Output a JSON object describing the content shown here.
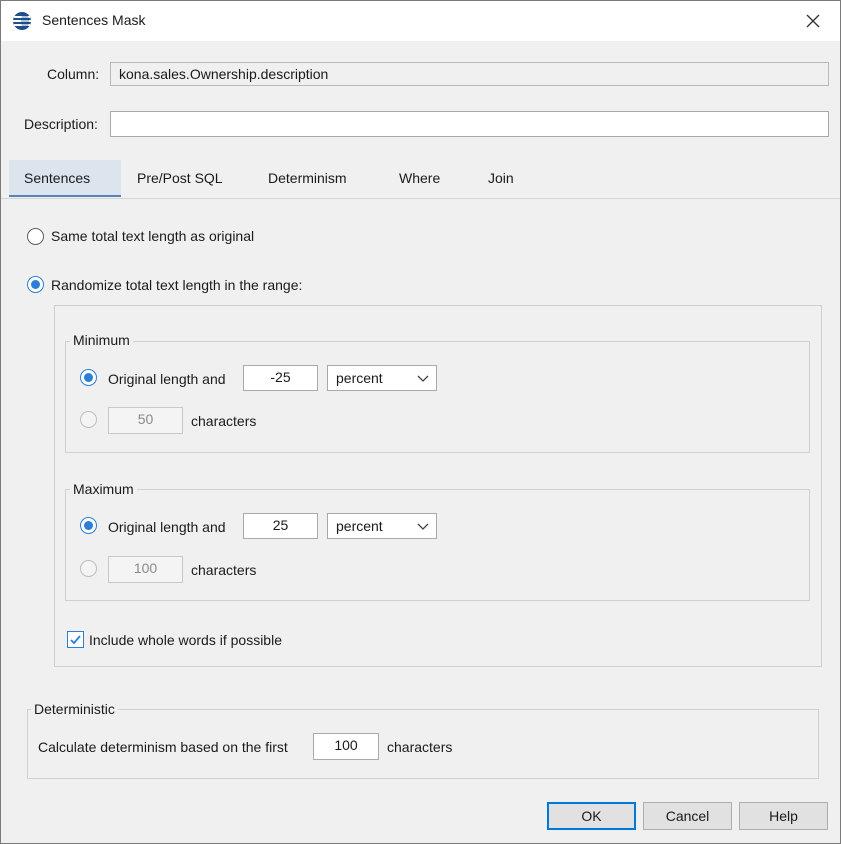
{
  "window": {
    "title": "Sentences Mask"
  },
  "column": {
    "label": "Column:",
    "value": "kona.sales.Ownership.description"
  },
  "description": {
    "label": "Description:",
    "value": ""
  },
  "tabs": [
    {
      "label": "Sentences",
      "active": true
    },
    {
      "label": "Pre/Post SQL",
      "active": false
    },
    {
      "label": "Determinism",
      "active": false
    },
    {
      "label": "Where",
      "active": false
    },
    {
      "label": "Join",
      "active": false
    }
  ],
  "options": {
    "same_length_label": "Same total text length as original",
    "randomize_label": "Randomize total text length in the range:",
    "selected": "randomize"
  },
  "minimum": {
    "title": "Minimum",
    "original_label": "Original length and",
    "original_value": "-25",
    "unit": "percent",
    "chars_value": "50",
    "chars_label": "characters",
    "selected": "original"
  },
  "maximum": {
    "title": "Maximum",
    "original_label": "Original length and",
    "original_value": "25",
    "unit": "percent",
    "chars_value": "100",
    "chars_label": "characters",
    "selected": "original"
  },
  "whole_words": {
    "label": "Include whole words if possible",
    "checked": true
  },
  "deterministic": {
    "title": "Deterministic",
    "prefix": "Calculate determinism based on the first",
    "value": "100",
    "suffix": "characters"
  },
  "buttons": {
    "ok": "OK",
    "cancel": "Cancel",
    "help": "Help"
  },
  "colors": {
    "accent": "#2b7fd6",
    "tab_active_bg": "#dce4ee",
    "dialog_bg": "#f0f0f0"
  }
}
